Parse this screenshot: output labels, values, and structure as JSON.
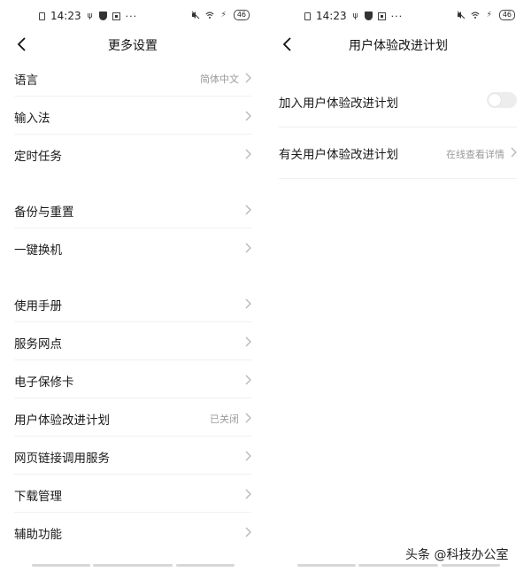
{
  "status": {
    "time": "14:23",
    "battery": "46",
    "more": "···"
  },
  "left": {
    "title": "更多设置",
    "groups": [
      [
        {
          "label": "语言",
          "value": "简体中文"
        },
        {
          "label": "输入法",
          "value": ""
        },
        {
          "label": "定时任务",
          "value": ""
        }
      ],
      [
        {
          "label": "备份与重置",
          "value": ""
        },
        {
          "label": "一键换机",
          "value": ""
        }
      ],
      [
        {
          "label": "使用手册",
          "value": ""
        },
        {
          "label": "服务网点",
          "value": ""
        },
        {
          "label": "电子保修卡",
          "value": ""
        },
        {
          "label": "用户体验改进计划",
          "value": "已关闭"
        },
        {
          "label": "网页链接调用服务",
          "value": ""
        },
        {
          "label": "下载管理",
          "value": ""
        },
        {
          "label": "辅助功能",
          "value": ""
        }
      ]
    ]
  },
  "right": {
    "title": "用户体验改进计划",
    "join_label": "加入用户体验改进计划",
    "join_enabled": false,
    "about_label": "有关用户体验改进计划",
    "about_value": "在线查看详情"
  },
  "watermark": "头条 @科技办公室",
  "colors": {
    "text": "#1a1a1a",
    "secondary": "#9a9a9a",
    "toggle_off": "#ededed",
    "divider": "#f0f0f0"
  },
  "icons": {
    "back": "back-chevron-icon",
    "row": "chevron-right-icon",
    "status": [
      "sim-icon",
      "usb-icon",
      "shield-icon",
      "chip-icon",
      "mute-icon",
      "wifi-icon",
      "charging-icon",
      "battery-icon"
    ]
  }
}
